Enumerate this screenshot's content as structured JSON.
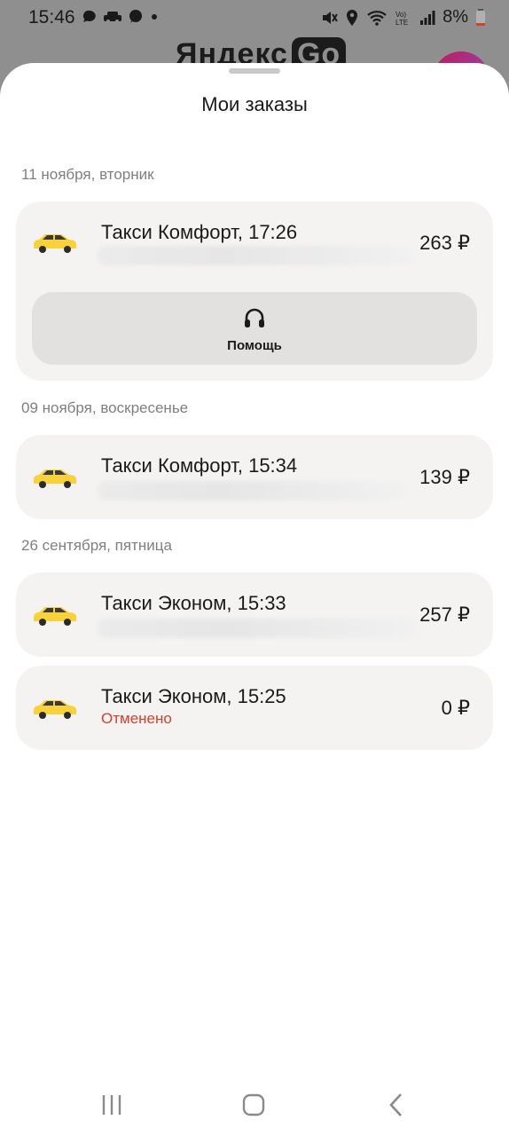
{
  "status_bar": {
    "time": "15:46",
    "battery": "8%",
    "icons": [
      "chat-bubble-icon",
      "car-icon",
      "message-icon",
      "dot-icon",
      "mute-icon",
      "location-icon",
      "wifi-icon",
      "volte-icon",
      "signal-icon",
      "battery-icon"
    ]
  },
  "backdrop": {
    "logo_text": "Яндекс",
    "logo_badge": "Go"
  },
  "sheet": {
    "title": "Мои заказы"
  },
  "groups": [
    {
      "date": "11 ноября, вторник",
      "orders": [
        {
          "title": "Такси Комфорт, 17:26",
          "price": "263 ₽",
          "help_label": "Помощь"
        }
      ]
    },
    {
      "date": "09 ноября, воскресенье",
      "orders": [
        {
          "title": "Такси Комфорт, 15:34",
          "price": "139 ₽"
        }
      ]
    },
    {
      "date": "26 сентября, пятница",
      "orders": [
        {
          "title": "Такси Эконом, 15:33",
          "price": "257 ₽"
        },
        {
          "title": "Такси Эконом, 15:25",
          "price": "0 ₽",
          "status": "Отменено"
        }
      ]
    }
  ],
  "colors": {
    "card_bg": "#f4f3f1",
    "help_bg": "#e2e1df",
    "taxi_yellow": "#f7d23a",
    "cancelled_red": "#d2402f"
  },
  "navbar": [
    "recents-icon",
    "home-icon",
    "back-icon"
  ]
}
